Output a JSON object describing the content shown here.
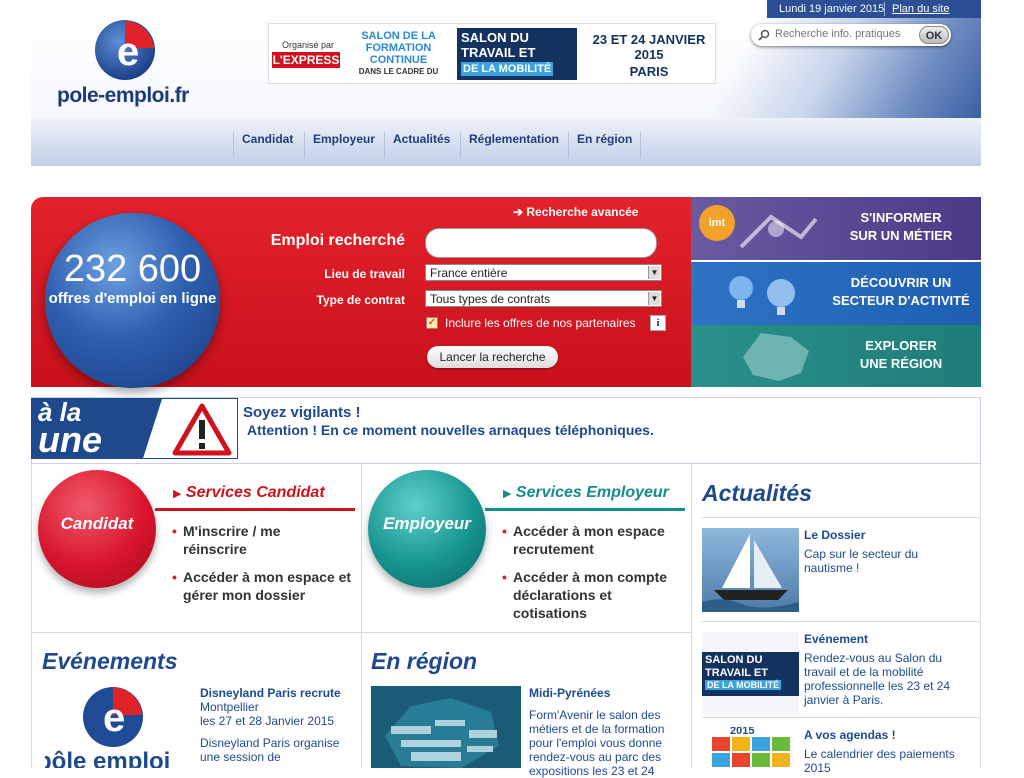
{
  "header": {
    "date": "Lundi 19 janvier 2015",
    "sitemap": "Plan du site",
    "search_placeholder": "Recherche info. pratiques",
    "search_ok": "OK",
    "logo_text": "pole-emploi.fr",
    "banner": {
      "organise_par": "Organisé par",
      "express": "L'EXPRESS",
      "salon_formation": "SALON DE LA FORMATION CONTINUE",
      "dans_le_cadre": "DANS LE CADRE DU",
      "salon_du": "SALON DU",
      "travail_et": "TRAVAIL ET",
      "de_la_mobilite": "DE LA MOBILITÉ",
      "dates": "23 ET 24 JANVIER 2015",
      "city": "PARIS"
    }
  },
  "nav": [
    "Candidat",
    "Employeur",
    "Actualités",
    "Réglementation",
    "En région"
  ],
  "search": {
    "advanced": "Recherche avancée",
    "offers_count": "232 600",
    "offers_sub": "offres d'emploi en ligne",
    "job_label": "Emploi recherché",
    "place_label": "Lieu de travail",
    "place_value": "France entière",
    "contract_label": "Type de contrat",
    "contract_value": "Tous types de contrats",
    "partners": "Inclure les offres de nos partenaires",
    "launch": "Lancer la recherche"
  },
  "side_tiles": [
    {
      "line1": "S'INFORMER",
      "line2": "SUR UN MÉTIER",
      "badge": "imt"
    },
    {
      "line1": "DÉCOUVRIR UN",
      "line2": "SECTEUR D'ACTIVITÉ"
    },
    {
      "line1": "EXPLORER",
      "line2": "UNE RÉGION"
    }
  ],
  "alaune": {
    "logo_line1": "à la",
    "logo_line2": "une",
    "title": "Soyez vigilants !",
    "text": "Attention ! En ce moment nouvelles arnaques téléphoniques."
  },
  "candidat": {
    "bubble": "Candidat",
    "title": "Services Candidat",
    "links": [
      "M'inscrire / me réinscrire",
      "Accéder à mon espace et gérer mon dossier"
    ]
  },
  "employeur": {
    "bubble": "Employeur",
    "title": "Services Employeur",
    "links": [
      "Accéder à mon espace recrutement",
      "Accéder à mon compte déclarations et cotisations"
    ]
  },
  "evenements": {
    "heading": "Evénements",
    "item_title": "Disneyland Paris recrute",
    "item_place": "Montpellier",
    "item_date": "les 27 et 28 Janvier 2015",
    "item_body": "Disneyland Paris organise une session de",
    "logo_text": "pôle emploi"
  },
  "region": {
    "heading": "En région",
    "item_title": "Midi-Pyrénées",
    "item_body": "Form'Avenir le salon des métiers et de la formation pour l'emploi vous donne rendez-vous au parc des expositions les 23 et 24"
  },
  "actualites": {
    "heading": "Actualités",
    "items": [
      {
        "title": "Le Dossier",
        "body": "Cap sur le secteur du nautisme !"
      },
      {
        "title": "Evénement",
        "body": "Rendez-vous au Salon du travail et de la mobilité professionnelle les 23 et 24 janvier à Paris."
      },
      {
        "title": "A vos agendas !",
        "body": "Le calendrier des paiements 2015"
      }
    ],
    "thumb2": {
      "l1": "SALON DU",
      "l2": "TRAVAIL ET",
      "l3": "DE LA MOBILITÉ"
    },
    "thumb3_year": "2015"
  },
  "colors": {
    "red": "#d0121e",
    "navy": "#1e4a8d",
    "teal": "#148b8f"
  }
}
